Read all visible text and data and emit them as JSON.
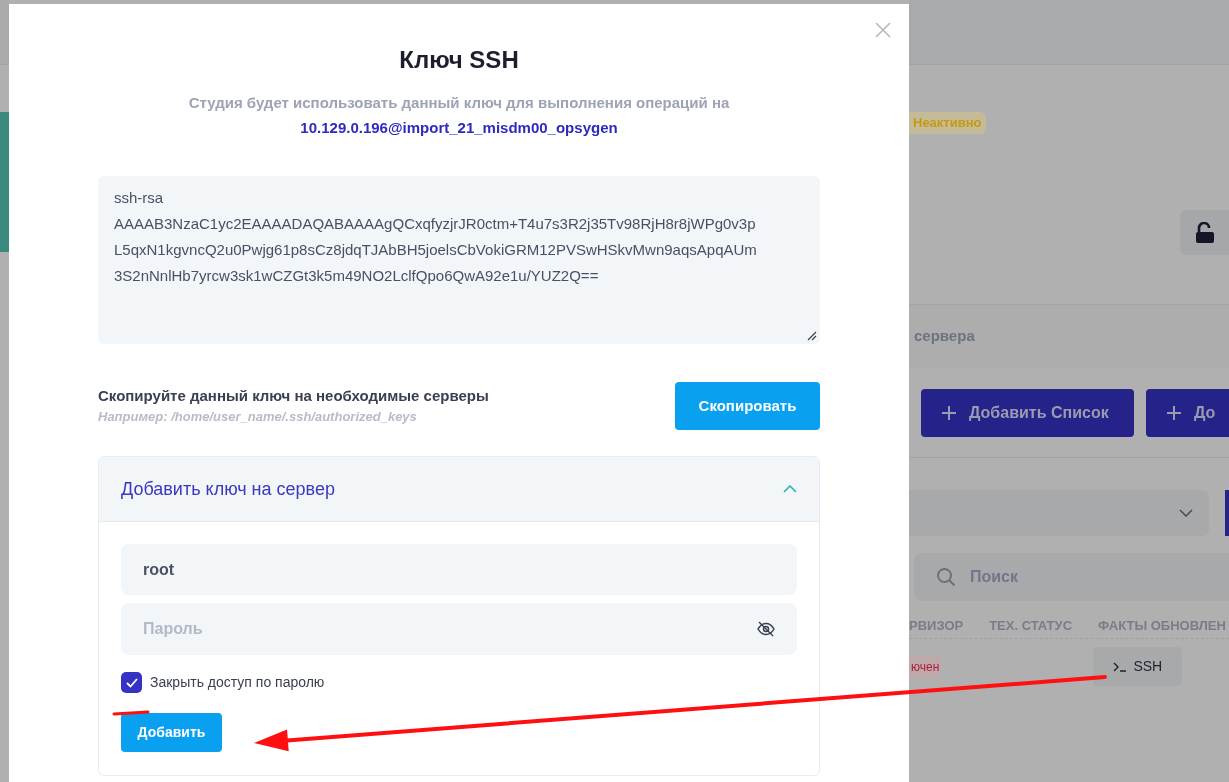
{
  "background": {
    "status_badge": "Неактивно",
    "tab": "сервера",
    "buttons": [
      {
        "label": "Добавить Список"
      },
      {
        "label": "До"
      }
    ],
    "search": {
      "placeholder": "Поиск"
    },
    "table": {
      "columns": [
        "РВИЗОР",
        "ТЕХ. СТАТУС",
        "ФАКТЫ ОБНОВЛЕН"
      ],
      "rows": [
        {
          "status": "ючен",
          "action": "SSH"
        }
      ]
    }
  },
  "dialog": {
    "title": "Ключ SSH",
    "subtitle": "Студия будет использовать данный ключ для выполнения операций на",
    "host": "10.129.0.196@import_21_misdm00_opsygen",
    "key_lines": [
      "ssh-rsa",
      "AAAAB3NzaC1yc2EAAAADAQABAAAAgQCxqfyzjrJR0ctm+T4u7s3R2j35Tv98RjH8r8jWPg0v3p",
      "L5qxN1kgvncQ2u0Pwjg61p8sCz8jdqTJAbBH5joelsCbVokiGRM12PVSwHSkvMwn9aqsApqAUm",
      "3S2nNnlHb7yrcw3sk1wCZGt3k5m49NO2LclfQpo6QwA92e1u/YUZ2Q=="
    ],
    "copy_hint": "Скопируйте данный ключ на необходимые серверы",
    "copy_example": "Например: /home/user_name/.ssh/authorized_keys",
    "copy_button": "Скопировать",
    "accordion": {
      "title": "Добавить ключ на сервер",
      "expanded": true,
      "login": {
        "value": "root"
      },
      "password": {
        "placeholder": "Пароль"
      },
      "close_password": {
        "label": "Закрыть доступ по паролю",
        "checked": true
      },
      "submit": "Добавить"
    }
  },
  "annotations": [
    {
      "kind": "underline"
    },
    {
      "kind": "arrow"
    }
  ]
}
